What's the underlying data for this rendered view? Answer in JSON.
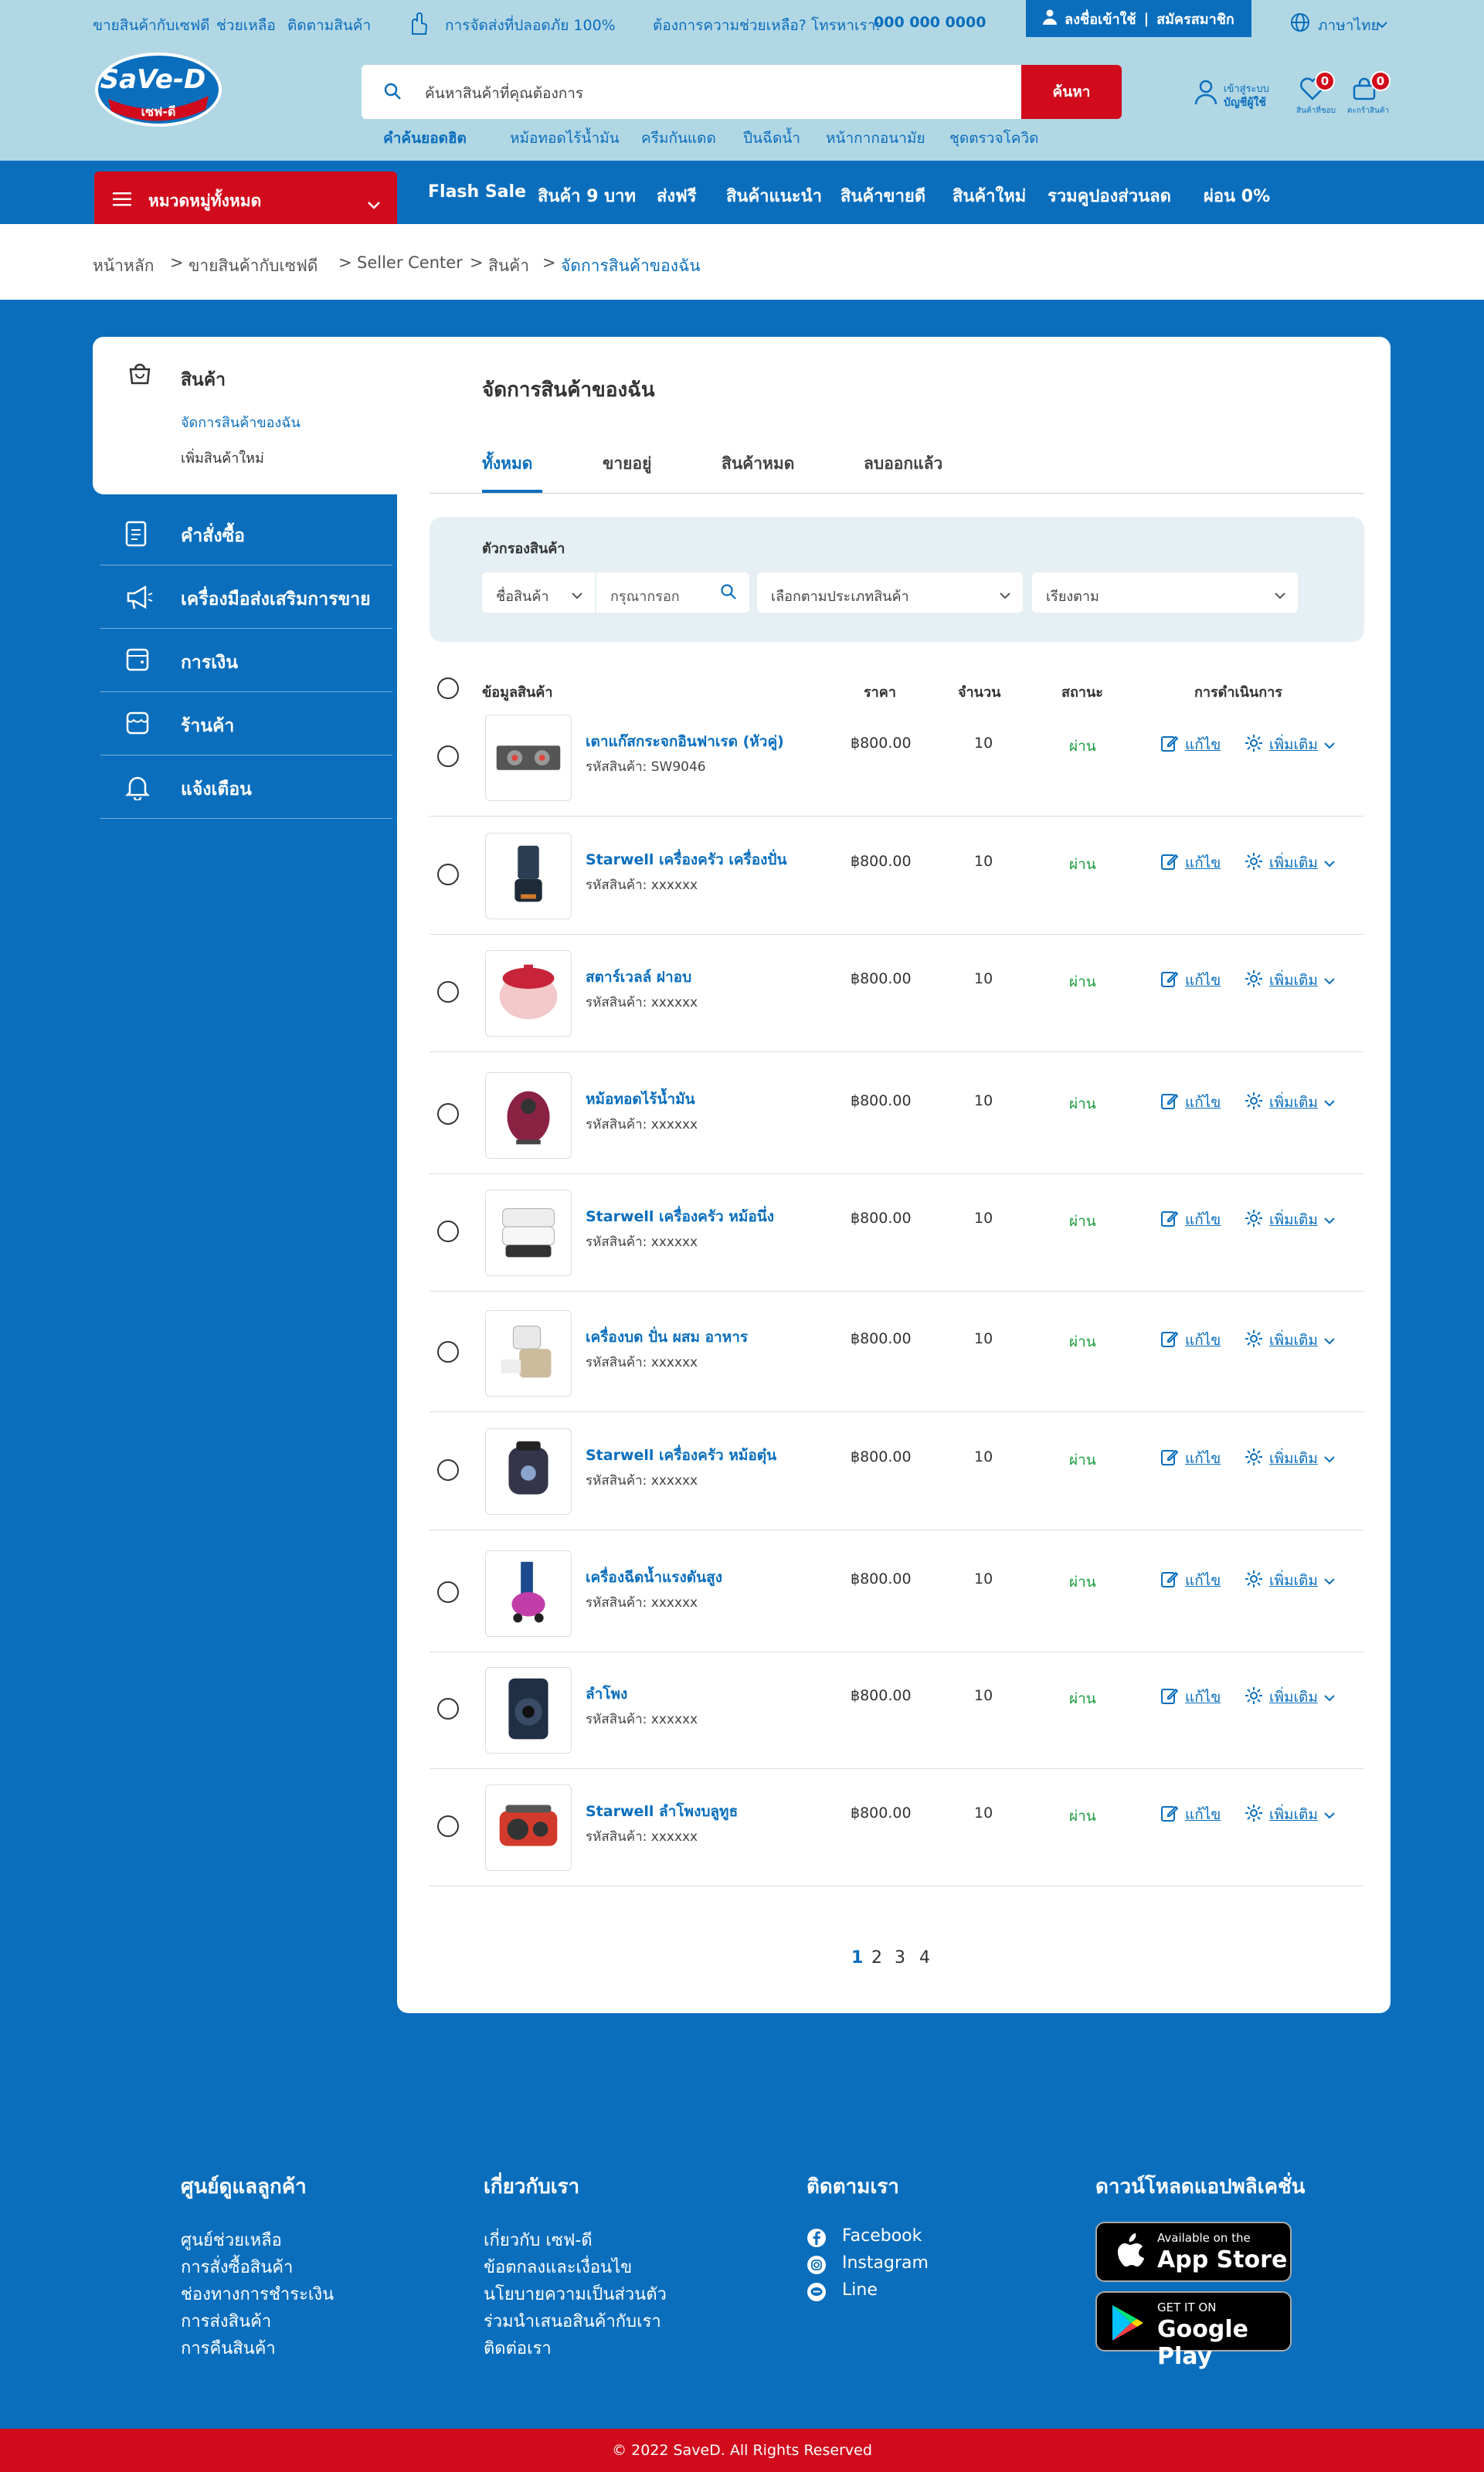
{
  "topbar": {
    "links": [
      "ขายสินค้ากับเซฟดี",
      "ช่วยเหลือ",
      "ติดตามสินค้า"
    ],
    "shipping": "การจัดส่งที่ปลอดภัย 100%",
    "help_prefix": "ต้องการความช่วยเหลือ? โทรหาเรา:",
    "phone": "000 000 0000",
    "login": "ลงชื่อเข้าใช้",
    "register": "สมัครสมาชิก",
    "language": "ภาษาไทย"
  },
  "brand": {
    "logo_text": "SaVe-D",
    "logo_thai": "เซฟ-ดี"
  },
  "search": {
    "placeholder": "ค้นหาสินค้าที่คุณต้องการ",
    "button": "ค้นหา",
    "popular_label": "คำค้นยอดฮิต",
    "popular": [
      "หม้อทอดไร้น้ำมัน",
      "ครีมกันแดด",
      "ปืนฉีดน้ำ",
      "หน้ากากอนามัย",
      "ชุดตรวจโควิด"
    ]
  },
  "account": {
    "line1": "เข้าสู่ระบบ",
    "line2": "บัญชีผู้ใช้",
    "wishlist_label": "สินค้าที่ชอบ",
    "wishlist_count": "0",
    "cart_label": "ตะกร้าสินค้า",
    "cart_count": "0"
  },
  "nav": {
    "categories": "หมวดหมู่ทั้งหมด",
    "items": [
      "Flash Sale",
      "สินค้า 9 บาท",
      "ส่งฟรี",
      "สินค้าแนะนำ",
      "สินค้าขายดี",
      "สินค้าใหม่",
      "รวมคูปองส่วนลด",
      "ผ่อน 0%"
    ]
  },
  "breadcrumb": [
    "หน้าหลัก",
    "ขายสินค้ากับเซฟดี",
    "Seller Center",
    "สินค้า",
    "จัดการสินค้าของฉัน"
  ],
  "sidebar": {
    "products": "สินค้า",
    "manage": "จัดการสินค้าของฉัน",
    "add": "เพิ่มสินค้าใหม่",
    "items": [
      "คำสั่งซื้อ",
      "เครื่องมือส่งเสริมการขาย",
      "การเงิน",
      "ร้านค้า",
      "แจ้งเตือน"
    ]
  },
  "main": {
    "title": "จัดการสินค้าของฉัน",
    "tabs": [
      "ทั้งหมด",
      "ขายอยู่",
      "สินค้าหมด",
      "ลบออกแล้ว"
    ],
    "filter_label": "ตัวกรองสินค้า",
    "filter_field": "ชื่อสินค้า",
    "filter_input_placeholder": "กรุณากรอก",
    "filter_category": "เลือกตามประเภทสินค้า",
    "filter_sort": "เรียงตาม",
    "columns": [
      "ข้อมูลสินค้า",
      "ราคา",
      "จำนวน",
      "สถานะ",
      "การดำเนินการ"
    ],
    "edit_label": "แก้ไข",
    "more_label": "เพิ่มเติม",
    "pages": [
      "1",
      "2",
      "3",
      "4"
    ]
  },
  "products": [
    {
      "name": "เตาแก๊สกระจกอินฟาเรด (หัวคู่)",
      "sku": "รหัสสินค้า: SW9046",
      "price": "฿800.00",
      "qty": "10",
      "status": "ผ่าน"
    },
    {
      "name": "Starwell เครื่องครัว เครื่องปั่น",
      "sku": "รหัสสินค้า: xxxxxx",
      "price": "฿800.00",
      "qty": "10",
      "status": "ผ่าน"
    },
    {
      "name": "สตาร์เวลล์ ฝาอบ",
      "sku": "รหัสสินค้า: xxxxxx",
      "price": "฿800.00",
      "qty": "10",
      "status": "ผ่าน"
    },
    {
      "name": "หม้อทอดไร้น้ำมัน",
      "sku": "รหัสสินค้า: xxxxxx",
      "price": "฿800.00",
      "qty": "10",
      "status": "ผ่าน"
    },
    {
      "name": "Starwell เครื่องครัว หม้อนึ่ง",
      "sku": "รหัสสินค้า: xxxxxx",
      "price": "฿800.00",
      "qty": "10",
      "status": "ผ่าน"
    },
    {
      "name": "เครื่องบด ปั่น ผสม อาหาร",
      "sku": "รหัสสินค้า: xxxxxx",
      "price": "฿800.00",
      "qty": "10",
      "status": "ผ่าน"
    },
    {
      "name": "Starwell เครื่องครัว หม้อตุ๋น",
      "sku": "รหัสสินค้า: xxxxxx",
      "price": "฿800.00",
      "qty": "10",
      "status": "ผ่าน"
    },
    {
      "name": "เครื่องฉีดน้ำแรงดันสูง",
      "sku": "รหัสสินค้า: xxxxxx",
      "price": "฿800.00",
      "qty": "10",
      "status": "ผ่าน"
    },
    {
      "name": "ลำโพง",
      "sku": "รหัสสินค้า: xxxxxx",
      "price": "฿800.00",
      "qty": "10",
      "status": "ผ่าน"
    },
    {
      "name": "Starwell ลำโพงบลูทูธ",
      "sku": "รหัสสินค้า: xxxxxx",
      "price": "฿800.00",
      "qty": "10",
      "status": "ผ่าน"
    }
  ],
  "footer": {
    "customer_title": "ศูนย์ดูแลลูกค้า",
    "customer_links": [
      "ศูนย์ช่วยเหลือ",
      "การสั่งซื้อสินค้า",
      "ช่องทางการชำระเงิน",
      "การส่งสินค้า",
      "การคืนสินค้า"
    ],
    "about_title": "เกี่ยวกับเรา",
    "about_links": [
      "เกี่ยวกับ เซฟ-ดี",
      "ข้อตกลงและเงื่อนไข",
      "นโยบายความเป็นส่วนตัว",
      "ร่วมนำเสนอสินค้ากับเรา",
      "ติดต่อเรา"
    ],
    "follow_title": "ติดตามเรา",
    "social": [
      "Facebook",
      "Instagram",
      "Line"
    ],
    "app_title": "ดาวน์โหลดแอปพลิเคชั่น",
    "appstore_small": "Available on the",
    "appstore_big": "App Store",
    "gplay_small": "GET IT ON",
    "gplay_big": "Google Play",
    "copyright": "© 2022 SaveD. All Rights Reserved"
  },
  "colors": {
    "primary": "#0a6ebd",
    "light": "#b2d7e4",
    "accent": "#d10b1c",
    "success": "#1a9c3c"
  }
}
